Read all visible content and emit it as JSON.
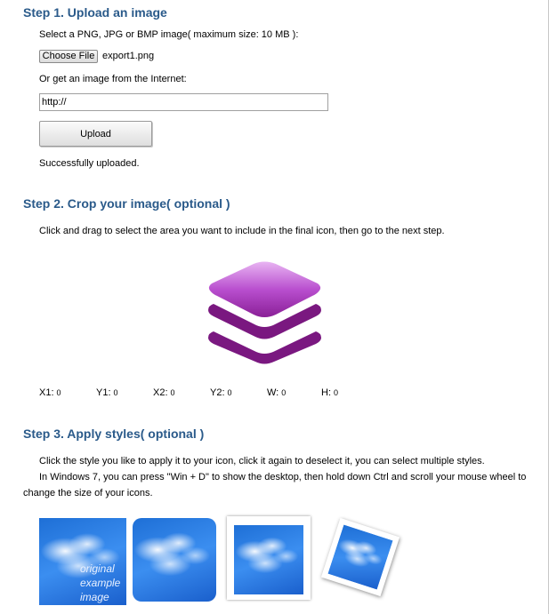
{
  "step1": {
    "title": "Step 1. Upload an image",
    "instruction": "Select a PNG, JPG or BMP image( maximum size: 10 MB ):",
    "choose_file_label": "Choose File",
    "file_name": "export1.png",
    "internet_label": "Or get an image from the Internet:",
    "url_value": "http://",
    "upload_label": "Upload",
    "status": "Successfully uploaded."
  },
  "step2": {
    "title": "Step 2. Crop your image( optional )",
    "instruction": "Click and drag to select the area you want to include in the final icon, then go to the next step.",
    "coords": [
      {
        "label": "X1:",
        "value": "0"
      },
      {
        "label": "Y1:",
        "value": "0"
      },
      {
        "label": "X2:",
        "value": "0"
      },
      {
        "label": "Y2:",
        "value": "0"
      },
      {
        "label": "W:",
        "value": "0"
      },
      {
        "label": "H:",
        "value": "0"
      }
    ]
  },
  "step3": {
    "title": "Step 3. Apply styles( optional )",
    "line1": "Click the style you like to apply it to your icon, click it again to deselect it, you can select multiple styles.",
    "line2": "In Windows 7, you can press \"Win + D\" to show the desktop, then hold down Ctrl and scroll your mouse wheel to",
    "line3": "change the size of your icons.",
    "original_caption": "original example image"
  },
  "colors": {
    "heading": "#2a5a8a",
    "icon_purple_light": "#d68ee6",
    "icon_purple_dark": "#7a1880",
    "sky_blue": "#2f7fe6"
  }
}
